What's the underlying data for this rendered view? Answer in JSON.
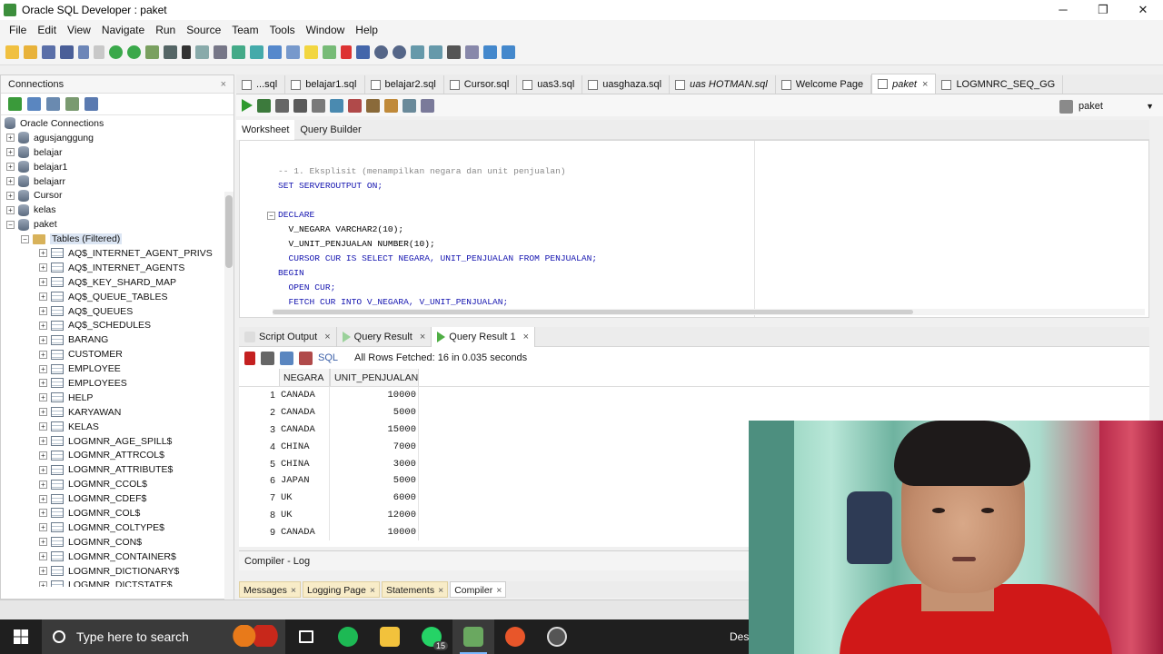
{
  "window": {
    "title": "Oracle SQL Developer : paket",
    "controls": [
      "─",
      "❐",
      "✕"
    ]
  },
  "menu": [
    "File",
    "Edit",
    "View",
    "Navigate",
    "Run",
    "Source",
    "Team",
    "Tools",
    "Window",
    "Help"
  ],
  "connections": {
    "panel_title": "Connections",
    "root": "Oracle Connections",
    "items": [
      "agusjanggung",
      "belajar",
      "belajar1",
      "belajarr",
      "Cursor",
      "kelas",
      "paket"
    ],
    "tables_node": "Tables (Filtered)",
    "tables": [
      "AQ$_INTERNET_AGENT_PRIVS",
      "AQ$_INTERNET_AGENTS",
      "AQ$_KEY_SHARD_MAP",
      "AQ$_QUEUE_TABLES",
      "AQ$_QUEUES",
      "AQ$_SCHEDULES",
      "BARANG",
      "CUSTOMER",
      "EMPLOYEE",
      "EMPLOYEES",
      "HELP",
      "KARYAWAN",
      "KELAS",
      "LOGMNR_AGE_SPILL$",
      "LOGMNR_ATTRCOL$",
      "LOGMNR_ATTRIBUTE$",
      "LOGMNR_CCOL$",
      "LOGMNR_CDEF$",
      "LOGMNR_COL$",
      "LOGMNR_COLTYPE$",
      "LOGMNR_CON$",
      "LOGMNR_CONTAINER$",
      "LOGMNR_DICTIONARY$",
      "LOGMNR_DICTSTATE$"
    ]
  },
  "tabs": [
    {
      "label": "...sql",
      "italic": false,
      "active": false
    },
    {
      "label": "belajar1.sql",
      "italic": false,
      "active": false
    },
    {
      "label": "belajar2.sql",
      "italic": false,
      "active": false
    },
    {
      "label": "Cursor.sql",
      "italic": false,
      "active": false
    },
    {
      "label": "uas3.sql",
      "italic": false,
      "active": false
    },
    {
      "label": "uasghaza.sql",
      "italic": false,
      "active": false
    },
    {
      "label": "uas HOTMAN.sql",
      "italic": true,
      "active": false
    },
    {
      "label": "Welcome Page",
      "italic": false,
      "active": false
    },
    {
      "label": "paket",
      "italic": true,
      "active": true
    },
    {
      "label": "LOGMNRC_SEQ_GG",
      "italic": false,
      "active": false
    }
  ],
  "connection_select": "paket",
  "worksheet_tabs": [
    "Worksheet",
    "Query Builder"
  ],
  "code_lines": [
    {
      "indent": "",
      "text": "-- 1. Eksplisit (menampilkan negara dan unit penjualan)",
      "kind": "comment"
    },
    {
      "indent": "",
      "text": "SET SERVEROUTPUT ON;",
      "kind": "kw"
    },
    {
      "indent": "",
      "text": "",
      "kind": "plain"
    },
    {
      "indent": "",
      "text": "DECLARE",
      "kind": "kw"
    },
    {
      "indent": "  ",
      "text": "V_NEGARA VARCHAR2(10);",
      "kind": "decl"
    },
    {
      "indent": "  ",
      "text": "V_UNIT_PENJUALAN NUMBER(10);",
      "kind": "decl"
    },
    {
      "indent": "  ",
      "text": "CURSOR CUR IS SELECT NEGARA, UNIT_PENJUALAN FROM PENJUALAN;",
      "kind": "kw"
    },
    {
      "indent": "",
      "text": "BEGIN",
      "kind": "kw"
    },
    {
      "indent": "  ",
      "text": "OPEN CUR;",
      "kind": "kw"
    },
    {
      "indent": "  ",
      "text": "FETCH CUR INTO V_NEGARA, V_UNIT_PENJUALAN;",
      "kind": "kw"
    }
  ],
  "result_tabs": [
    {
      "label": "Script Output",
      "active": false,
      "icon": "none"
    },
    {
      "label": "Query Result",
      "active": false,
      "icon": "gray"
    },
    {
      "label": "Query Result 1",
      "active": true,
      "icon": "green"
    }
  ],
  "result_toolbar": {
    "sql_label": "SQL",
    "message": "All Rows Fetched: 16 in 0.035 seconds"
  },
  "grid": {
    "columns": [
      "NEGARA",
      "UNIT_PENJUALAN"
    ],
    "rows": [
      [
        "1",
        "CANADA",
        "10000"
      ],
      [
        "2",
        "CANADA",
        "5000"
      ],
      [
        "3",
        "CANADA",
        "15000"
      ],
      [
        "4",
        "CHINA",
        "7000"
      ],
      [
        "5",
        "CHINA",
        "3000"
      ],
      [
        "6",
        "JAPAN",
        "5000"
      ],
      [
        "7",
        "UK",
        "6000"
      ],
      [
        "8",
        "UK",
        "12000"
      ],
      [
        "9",
        "CANADA",
        "10000"
      ]
    ]
  },
  "compiler_log": "Compiler - Log",
  "bottom_tabs": [
    {
      "label": "Messages",
      "active": false
    },
    {
      "label": "Logging Page",
      "active": false
    },
    {
      "label": "Statements",
      "active": false
    },
    {
      "label": "Compiler",
      "active": true
    }
  ],
  "taskbar": {
    "search_placeholder": "Type here to search",
    "whatsapp_badge": "15",
    "desktop_label": "Desk"
  }
}
